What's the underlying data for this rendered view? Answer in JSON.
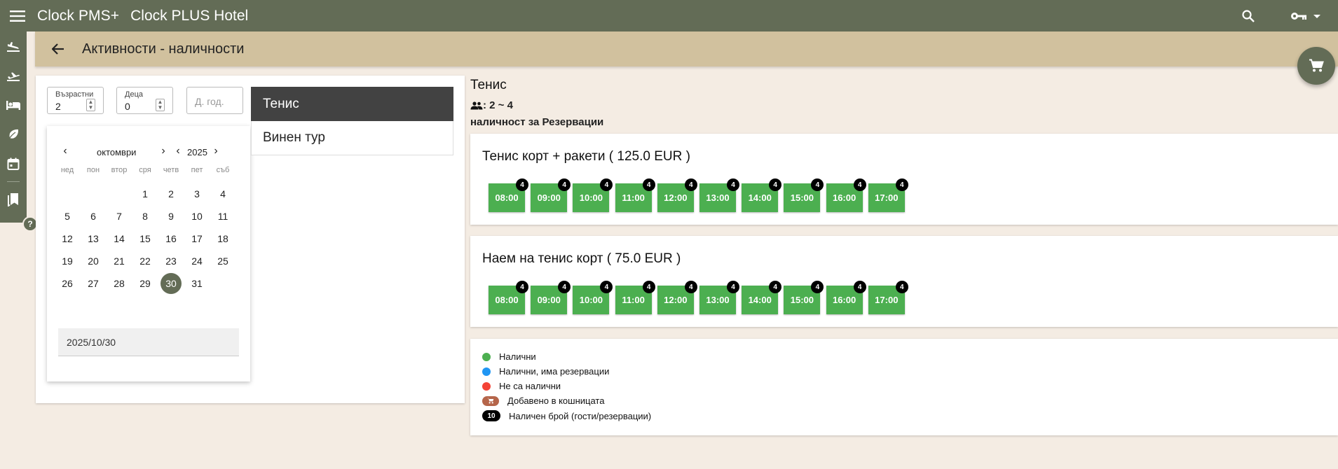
{
  "topbar": {
    "app_title": "Clock PMS+",
    "hotel_title": "Clock PLUS Hotel",
    "icons": [
      "menu-icon",
      "search-icon",
      "key-icon",
      "caret-down-icon"
    ]
  },
  "rail": {
    "items": [
      "flight-land-icon",
      "flight-takeoff-icon",
      "hotel-bed-icon",
      "eco-leaf-icon",
      "calendar-icon",
      "bookmarks-icon"
    ],
    "help_label": "?"
  },
  "header": {
    "title": "Активности - наличности"
  },
  "filters": {
    "adults_label": "Възрастни",
    "adults_value": "2",
    "children_label": "Деца",
    "children_value": "0",
    "birthdate_placeholder": "Д. год."
  },
  "calendar": {
    "month": "октомври",
    "year": "2025",
    "weekdays": [
      "нед",
      "пон",
      "втор",
      "сря",
      "четв",
      "пет",
      "съб"
    ],
    "weeks": [
      [
        "",
        "",
        "",
        "1",
        "2",
        "3",
        "4"
      ],
      [
        "5",
        "6",
        "7",
        "8",
        "9",
        "10",
        "11"
      ],
      [
        "12",
        "13",
        "14",
        "15",
        "16",
        "17",
        "18"
      ],
      [
        "19",
        "20",
        "21",
        "22",
        "23",
        "24",
        "25"
      ],
      [
        "26",
        "27",
        "28",
        "29",
        "30",
        "31",
        ""
      ]
    ],
    "selected_day": "30",
    "date_value": "2025/10/30"
  },
  "activities": [
    {
      "label": "Тенис",
      "active": true
    },
    {
      "label": "Винен тур",
      "active": false
    }
  ],
  "detail": {
    "title": "Тенис",
    "capacity": ": 2 ~ 4",
    "subtitle": "наличност за Резервации",
    "offers": [
      {
        "title": "Тенис корт + ракети ( 125.0 EUR )",
        "slots": [
          {
            "time": "08:00",
            "count": "4"
          },
          {
            "time": "09:00",
            "count": "4"
          },
          {
            "time": "10:00",
            "count": "4"
          },
          {
            "time": "11:00",
            "count": "4"
          },
          {
            "time": "12:00",
            "count": "4"
          },
          {
            "time": "13:00",
            "count": "4"
          },
          {
            "time": "14:00",
            "count": "4"
          },
          {
            "time": "15:00",
            "count": "4"
          },
          {
            "time": "16:00",
            "count": "4"
          },
          {
            "time": "17:00",
            "count": "4"
          }
        ]
      },
      {
        "title": "Наем на тенис корт ( 75.0 EUR )",
        "slots": [
          {
            "time": "08:00",
            "count": "4"
          },
          {
            "time": "09:00",
            "count": "4"
          },
          {
            "time": "10:00",
            "count": "4"
          },
          {
            "time": "11:00",
            "count": "4"
          },
          {
            "time": "12:00",
            "count": "4"
          },
          {
            "time": "13:00",
            "count": "4"
          },
          {
            "time": "14:00",
            "count": "4"
          },
          {
            "time": "15:00",
            "count": "4"
          },
          {
            "time": "16:00",
            "count": "4"
          },
          {
            "time": "17:00",
            "count": "4"
          }
        ]
      }
    ]
  },
  "legend": {
    "available": "Налични",
    "available_reserved": "Налични, има резервации",
    "unavailable": "Не са налични",
    "in_cart": "Добавено в кошницата",
    "count_badge": "10",
    "count_label": "Наличен брой (гости/резервации)"
  },
  "colors": {
    "primary": "#636c56",
    "header": "#d1c19e",
    "background": "#f4ece3",
    "available": "#4caf50",
    "reserved": "#2196f3",
    "unavailable": "#f44336",
    "cart": "#b5654a"
  }
}
